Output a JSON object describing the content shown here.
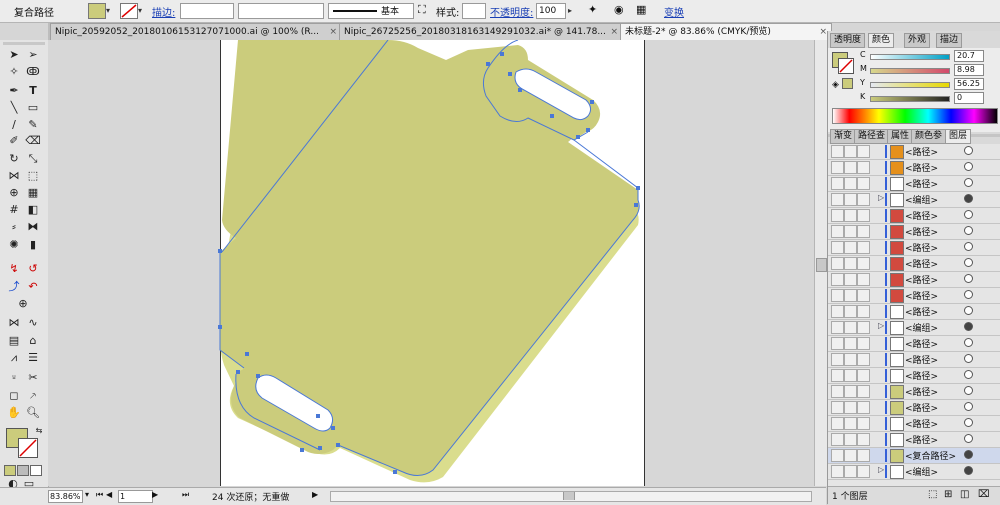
{
  "control_bar": {
    "selection_type": "复合路径",
    "stroke_label": "描边:",
    "stroke_profile": "基本",
    "style_label": "样式:",
    "opacity_label": "不透明度:",
    "opacity_value": "100",
    "transform_label": "变换",
    "fill_color": "#cbcc7c"
  },
  "tabs": [
    {
      "label": "Nipic_20592052_20180106153127071000.ai @ 100% (R...",
      "close": "×"
    },
    {
      "label": "Nipic_26725256_20180318163149291032.ai* @ 141.78...",
      "close": "×"
    },
    {
      "label": "未标题-2* @ 83.86% (CMYK/预览)",
      "close": "×"
    }
  ],
  "status_bar": {
    "zoom": "83.86%",
    "page": "1",
    "undo_text": "24 次还原；无重做"
  },
  "panels": {
    "top_tabs": [
      "透明度",
      "颜色",
      "外观",
      "描边"
    ],
    "color": {
      "fill_color": "#cbcc7c",
      "channels": [
        {
          "label": "C",
          "value": "20.7"
        },
        {
          "label": "M",
          "value": "8.98"
        },
        {
          "label": "Y",
          "value": "56.25"
        },
        {
          "label": "K",
          "value": "0"
        }
      ]
    },
    "layer_tabs": [
      "渐变",
      "路径查",
      "属性",
      "颜色参",
      "图层"
    ],
    "layers": [
      {
        "name": "<路径>",
        "thumb": "#e5901c",
        "target": "empty"
      },
      {
        "name": "<路径>",
        "thumb": "#e5901c",
        "target": "empty"
      },
      {
        "name": "<路径>",
        "thumb": "#ffffff",
        "target": "empty"
      },
      {
        "name": "<编组>",
        "thumb": "#ffffff",
        "target": "filled",
        "group": true
      },
      {
        "name": "<路径>",
        "thumb": "#d24a3f",
        "target": "empty"
      },
      {
        "name": "<路径>",
        "thumb": "#d24a3f",
        "target": "empty"
      },
      {
        "name": "<路径>",
        "thumb": "#d24a3f",
        "target": "empty"
      },
      {
        "name": "<路径>",
        "thumb": "#d24a3f",
        "target": "empty"
      },
      {
        "name": "<路径>",
        "thumb": "#d24a3f",
        "target": "empty"
      },
      {
        "name": "<路径>",
        "thumb": "#d24a3f",
        "target": "empty"
      },
      {
        "name": "<路径>",
        "thumb": "#ffffff",
        "target": "empty"
      },
      {
        "name": "<编组>",
        "thumb": "#ffffff",
        "target": "filled",
        "group": true
      },
      {
        "name": "<路径>",
        "thumb": "#ffffff",
        "target": "empty"
      },
      {
        "name": "<路径>",
        "thumb": "#ffffff",
        "target": "empty"
      },
      {
        "name": "<路径>",
        "thumb": "#ffffff",
        "target": "empty"
      },
      {
        "name": "<路径>",
        "thumb": "#cbcc7c",
        "target": "empty"
      },
      {
        "name": "<路径>",
        "thumb": "#cbcc7c",
        "target": "empty"
      },
      {
        "name": "<路径>",
        "thumb": "#ffffff",
        "target": "empty"
      },
      {
        "name": "<路径>",
        "thumb": "#ffffff",
        "target": "empty"
      },
      {
        "name": "<复合路径>",
        "thumb": "#cbcc7c",
        "target": "filled",
        "selected": true
      },
      {
        "name": "<编组>",
        "thumb": "#ffffff",
        "target": "filled",
        "group": true
      }
    ],
    "layers_footer": "1 个图层"
  },
  "art": {
    "board_color": "#cbcc7c",
    "shadow_color": "#d9dd8c",
    "path_color": "#4a78d6"
  }
}
